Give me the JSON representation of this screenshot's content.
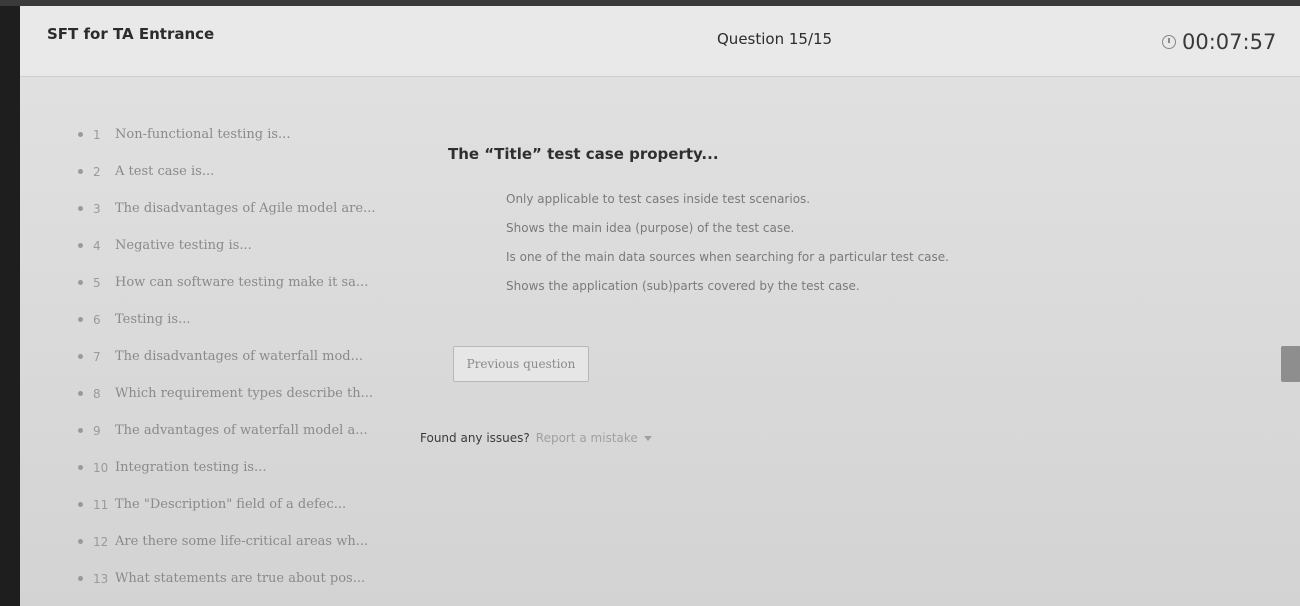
{
  "header": {
    "app_title": "SFT for TA Entrance",
    "question_counter": "Question 15/15",
    "timer": "00:07:57"
  },
  "question_list": [
    {
      "num": "1",
      "text": "Non-functional testing is..."
    },
    {
      "num": "2",
      "text": "A test case is..."
    },
    {
      "num": "3",
      "text": "The disadvantages of Agile model are..."
    },
    {
      "num": "4",
      "text": "Negative testing is..."
    },
    {
      "num": "5",
      "text": "How can software testing make it sa..."
    },
    {
      "num": "6",
      "text": "Testing is..."
    },
    {
      "num": "7",
      "text": "The disadvantages of waterfall mod..."
    },
    {
      "num": "8",
      "text": "Which requirement types describe th..."
    },
    {
      "num": "9",
      "text": "The advantages of waterfall model a..."
    },
    {
      "num": "10",
      "text": "Integration testing is..."
    },
    {
      "num": "11",
      "text": "The \"Description\" field of a defec..."
    },
    {
      "num": "12",
      "text": "Are there some life-critical areas wh..."
    },
    {
      "num": "13",
      "text": "What statements are true about pos..."
    }
  ],
  "question": {
    "title": "The “Title” test case property...",
    "options": [
      "Only applicable to test cases inside test scenarios.",
      "Shows the main idea (purpose) of the test case.",
      "Is one of the main data sources when searching for a particular test case.",
      "Shows the application (sub)parts covered by the test case."
    ]
  },
  "buttons": {
    "previous": "Previous question"
  },
  "footer": {
    "issues_label": "Found any issues?",
    "report_link": "Report a mistake"
  },
  "icons": {
    "timer": "clock-icon",
    "report_dropdown": "chevron-down-icon"
  }
}
